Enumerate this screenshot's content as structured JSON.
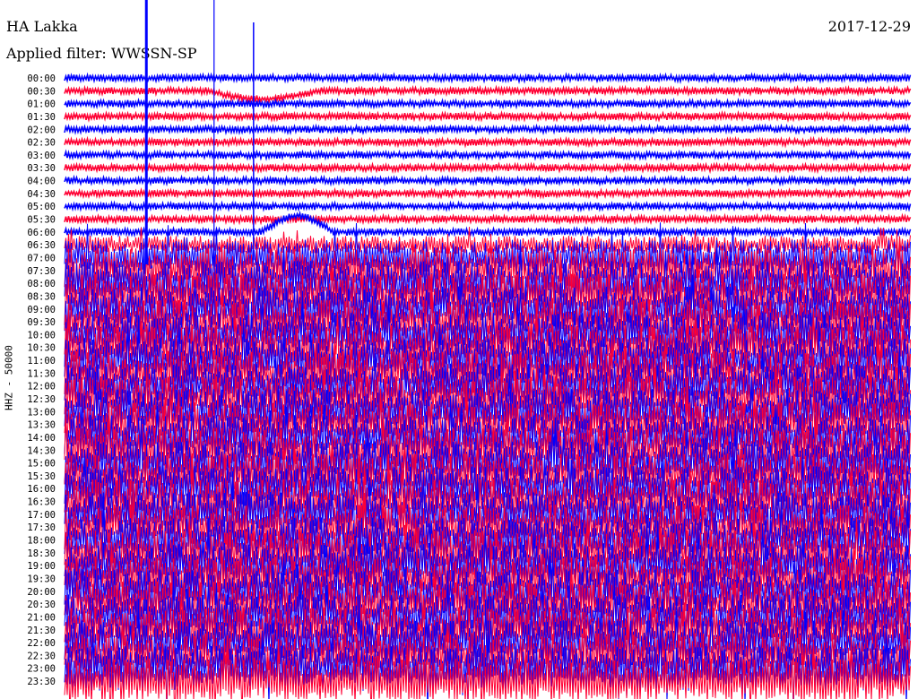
{
  "header": {
    "station": "HA Lakka",
    "filter": "Applied filter: WWSSN-SP",
    "date": "2017-12-29"
  },
  "chart_data": {
    "type": "line",
    "title": "HA Lakka",
    "ylabel": "HHZ - 50000",
    "minutes_per_row": 30,
    "row_labels": [
      "00:00",
      "00:30",
      "01:00",
      "01:30",
      "02:00",
      "02:30",
      "03:00",
      "03:30",
      "04:00",
      "04:30",
      "05:00",
      "05:30",
      "06:00",
      "06:30",
      "07:00",
      "07:30",
      "08:00",
      "08:30",
      "09:00",
      "09:30",
      "10:00",
      "10:30",
      "11:00",
      "11:30",
      "12:00",
      "12:30",
      "13:00",
      "13:30",
      "14:00",
      "14:30",
      "15:00",
      "15:30",
      "16:00",
      "16:30",
      "17:00",
      "17:30",
      "18:00",
      "18:30",
      "19:00",
      "19:30",
      "20:00",
      "20:30",
      "21:00",
      "21:30",
      "22:00",
      "22:30",
      "23:00",
      "23:30"
    ],
    "row_colors": [
      "#0000ff",
      "#ff0033"
    ],
    "relative_noise_level": [
      1,
      1,
      1,
      1,
      1,
      1,
      1,
      1,
      1,
      1,
      1,
      1,
      1,
      2,
      4,
      5,
      5,
      5,
      5,
      5,
      5,
      5,
      5,
      5,
      5,
      5,
      5,
      5,
      5,
      5,
      5,
      5,
      5,
      5,
      5,
      5,
      5,
      5,
      5,
      5,
      5,
      5,
      5,
      5,
      5,
      5,
      5,
      5
    ],
    "events": [
      {
        "row": "00:30",
        "minute_start": 5,
        "minute_end": 9,
        "shape": "long-period dip"
      },
      {
        "row": "06:00",
        "minute_start": 7,
        "minute_end": 9.5,
        "shape": "arch"
      },
      {
        "row": "00:00",
        "minute": 2.9,
        "shape": "large spike"
      },
      {
        "row": "00:00",
        "minute": 5.3,
        "shape": "spike"
      },
      {
        "row": "00:00",
        "minute": 6.7,
        "shape": "spike"
      }
    ]
  }
}
